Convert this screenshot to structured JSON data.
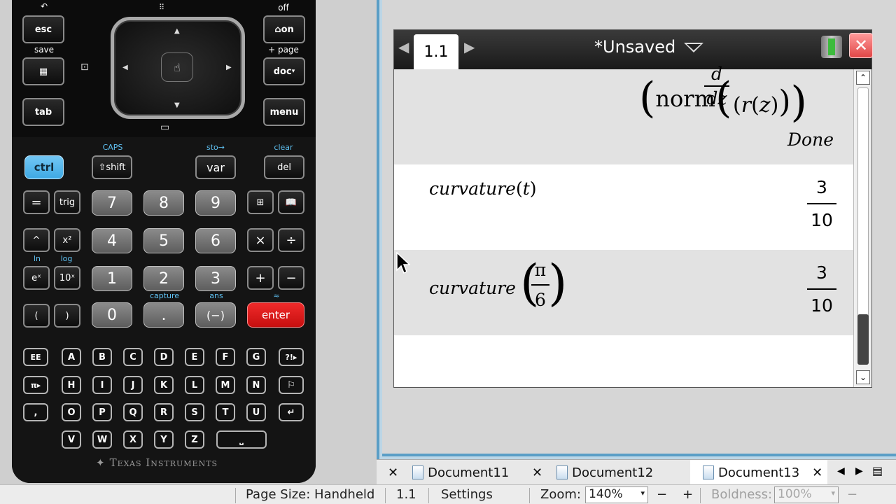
{
  "calculator": {
    "keys": {
      "esc": "esc",
      "on": "on",
      "doc": "doc",
      "tab": "tab",
      "menu": "menu",
      "ctrl": "ctrl",
      "shift": "shift",
      "var": "var",
      "del": "del",
      "eq": "=",
      "trig": "trig",
      "seven": "7",
      "eight": "8",
      "nine": "9",
      "caret": "^",
      "x2": "x²",
      "four": "4",
      "five": "5",
      "six": "6",
      "times": "×",
      "divide": "÷",
      "ex": "eˣ",
      "tenx": "10ˣ",
      "one": "1",
      "two": "2",
      "three": "3",
      "plus": "+",
      "minus": "−",
      "lparen": "(",
      "rparen": ")",
      "zero": "0",
      "dot": ".",
      "neg": "(−)",
      "enter": "enter",
      "ee": "EE",
      "pi": "π▸",
      "comma": ",",
      "qm": "?!▸",
      "space": "⎵",
      "return": "↵"
    },
    "labels": {
      "undo": "↶",
      "off": "off",
      "save": "save",
      "page": "+ page",
      "caps": "CAPS",
      "sto": "sto→",
      "clear": "clear",
      "ln": "ln",
      "log": "log",
      "capture": "capture",
      "ans": "ans",
      "approx": "≈"
    },
    "letters_row1": [
      "A",
      "B",
      "C",
      "D",
      "E",
      "F",
      "G"
    ],
    "letters_row2": [
      "H",
      "I",
      "J",
      "K",
      "L",
      "M",
      "N"
    ],
    "letters_row3": [
      "O",
      "P",
      "Q",
      "R",
      "S",
      "T",
      "U"
    ],
    "letters_row4": [
      "V",
      "W",
      "X",
      "Y",
      "Z"
    ],
    "brand": "Texas Instruments"
  },
  "document": {
    "page_tab": "1.1",
    "title": "*Unsaved",
    "history": {
      "line0_func": "norm",
      "line0_deriv_num": "d",
      "line0_deriv_den": "dz",
      "line0_r": "r",
      "line0_z": "z",
      "line0_result": "Done",
      "line1_func": "curvature",
      "line1_arg": "t",
      "line1_num": "3",
      "line1_den": "10",
      "line2_func": "curvature",
      "line2_arg_num": "π",
      "line2_arg_den": "6",
      "line2_num": "3",
      "line2_den": "10"
    }
  },
  "doc_tabs": [
    {
      "label": "Document11"
    },
    {
      "label": "Document12"
    },
    {
      "label": "Document13"
    }
  ],
  "status": {
    "page_size": "Page Size: Handheld",
    "page": "1.1",
    "settings": "Settings",
    "zoom_label": "Zoom:",
    "zoom_value": "140%",
    "zoom_minus": "−",
    "zoom_plus": "+",
    "boldness_label": "Boldness:",
    "boldness_value": "100%"
  }
}
